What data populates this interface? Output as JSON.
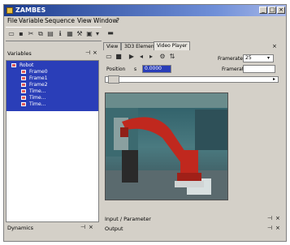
{
  "window": {
    "title": "ZAMBES"
  },
  "menu": [
    "File",
    "Variable",
    "Sequence",
    "View",
    "Window",
    "?"
  ],
  "toolbar_icons": [
    "new-icon",
    "save-icon",
    "cut-icon",
    "copy-icon",
    "paste-icon",
    "info-icon",
    "grid-icon",
    "tool-icon",
    "layers-icon",
    "fork-icon",
    "dropdown-icon",
    "monitor-icon"
  ],
  "left_panel": {
    "title": "Variables",
    "tree": [
      {
        "label": "Robot",
        "level": 0
      },
      {
        "label": "Frame0",
        "level": 1
      },
      {
        "label": "Frame1",
        "level": 1
      },
      {
        "label": "Frame2",
        "level": 1
      },
      {
        "label": "Time...",
        "level": 1
      },
      {
        "label": "Time...",
        "level": 1
      },
      {
        "label": "Time...",
        "level": 1
      }
    ],
    "footer": "Dynamics"
  },
  "right_panel": {
    "tabs": [
      "View",
      "3D3 Element",
      "Video Player"
    ],
    "active_tab": 2,
    "player": {
      "framerate_label": "Framerate",
      "framerate_value": "25",
      "position_label": "Position",
      "position_unit": "s",
      "position_value": "0.0000",
      "framerate2_label": "Framerate"
    },
    "bottom": [
      {
        "label": "Input / Parameter"
      },
      {
        "label": "Output"
      }
    ]
  }
}
